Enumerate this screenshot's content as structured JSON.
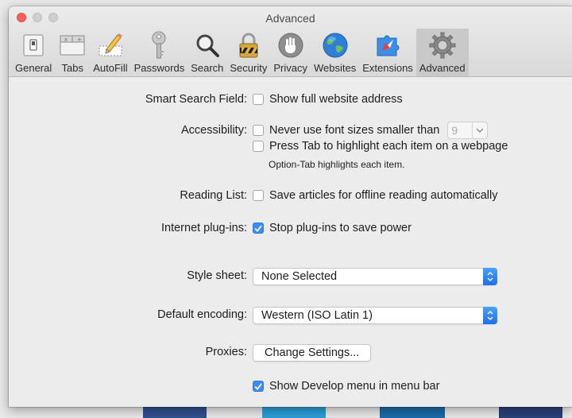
{
  "window": {
    "title": "Advanced"
  },
  "toolbar": {
    "tabs": [
      {
        "label": "General",
        "icon": "general-switch-icon"
      },
      {
        "label": "Tabs",
        "icon": "tabs-icon"
      },
      {
        "label": "AutoFill",
        "icon": "pencil-form-icon"
      },
      {
        "label": "Passwords",
        "icon": "key-icon"
      },
      {
        "label": "Search",
        "icon": "magnifier-icon"
      },
      {
        "label": "Security",
        "icon": "padlock-icon"
      },
      {
        "label": "Privacy",
        "icon": "hand-stop-icon"
      },
      {
        "label": "Websites",
        "icon": "globe-icon"
      },
      {
        "label": "Extensions",
        "icon": "puzzle-icon"
      },
      {
        "label": "Advanced",
        "icon": "gear-icon",
        "active": true
      }
    ]
  },
  "settings": {
    "smart_search": {
      "label": "Smart Search Field:",
      "option": "Show full website address",
      "checked": false
    },
    "accessibility": {
      "label": "Accessibility:",
      "font_option": "Never use font sizes smaller than",
      "font_checked": false,
      "font_size": "9",
      "tab_option": "Press Tab to highlight each item on a webpage",
      "tab_checked": false,
      "tab_note": "Option-Tab highlights each item."
    },
    "reading_list": {
      "label": "Reading List:",
      "option": "Save articles for offline reading automatically",
      "checked": false
    },
    "plugins": {
      "label": "Internet plug-ins:",
      "option": "Stop plug-ins to save power",
      "checked": true
    },
    "style_sheet": {
      "label": "Style sheet:",
      "value": "None Selected"
    },
    "encoding": {
      "label": "Default encoding:",
      "value": "Western (ISO Latin 1)"
    },
    "proxies": {
      "label": "Proxies:",
      "button": "Change Settings..."
    },
    "develop": {
      "option": "Show Develop menu in menu bar",
      "checked": true
    }
  },
  "colors": {
    "accent": "#3b8cf5",
    "close": "#fc605c"
  }
}
